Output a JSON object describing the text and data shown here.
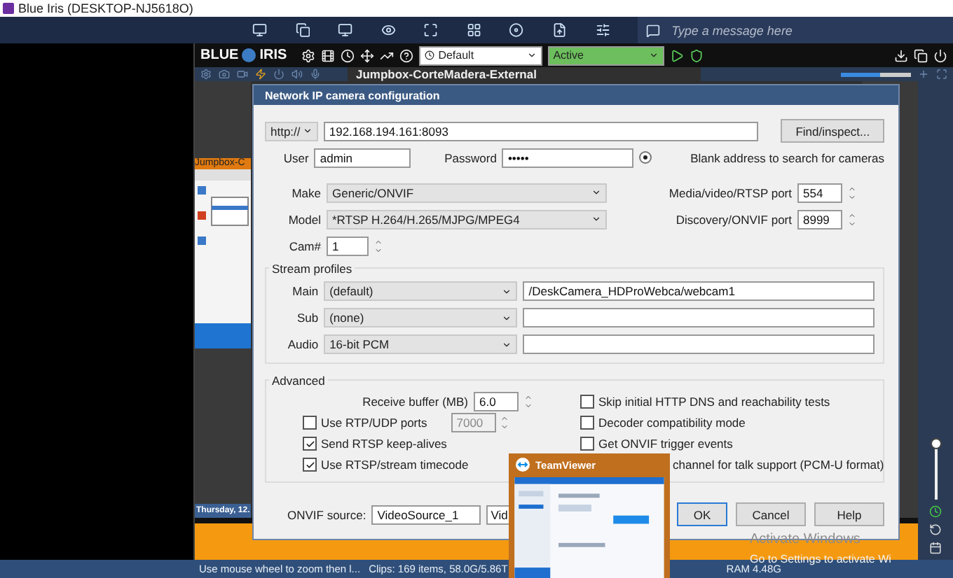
{
  "window": {
    "title": "Blue Iris (DESKTOP-NJ5618O)"
  },
  "remote_toolbar": {
    "message_placeholder": "Type a message here"
  },
  "app_toolbar": {
    "logo_left": "BLUE",
    "logo_right": "IRIS",
    "profile": "Default",
    "schedule": "Active"
  },
  "camera_bar": {
    "title": "Jumpbox-CorteMadera-External",
    "volume": {
      "level": 0.55
    }
  },
  "thumbnails": {
    "left_label": "Jumpbox-C",
    "date": "Thursday, 12."
  },
  "zoom_slider": {
    "level": 0.9
  },
  "dialog": {
    "title": "Network IP camera configuration",
    "protocol": "http://",
    "address": "192.168.194.161:8093",
    "find_button": "Find/inspect...",
    "user_label": "User",
    "user": "admin",
    "password_label": "Password",
    "password": "•••••",
    "hint": "Blank address to search for cameras",
    "make_label": "Make",
    "make": "Generic/ONVIF",
    "model_label": "Model",
    "model": "*RTSP H.264/H.265/MJPG/MPEG4",
    "cam_label": "Cam#",
    "cam": "1",
    "ports": [
      {
        "label": "Media/video/RTSP port",
        "value": "554"
      },
      {
        "label": "Discovery/ONVIF port",
        "value": "8999"
      }
    ],
    "stream_profiles": {
      "title": "Stream profiles",
      "rows": [
        {
          "label": "Main",
          "choice": "(default)",
          "path": "/DeskCamera_HDProWebca/webcam1"
        },
        {
          "label": "Sub",
          "choice": "(none)"
        },
        {
          "label": "Audio",
          "choice": "16-bit PCM"
        }
      ]
    },
    "advanced": {
      "title": "Advanced",
      "buffer_label": "Receive buffer (MB)",
      "buffer": "6.0",
      "left_options": [
        {
          "kind": "port",
          "label": "Use RTP/UDP ports",
          "checked": false,
          "value": "7000",
          "disabled": true
        },
        {
          "kind": "check",
          "label": "Send RTSP keep-alives",
          "checked": true
        },
        {
          "kind": "check",
          "label": "Use RTSP/stream timecode",
          "checked": true
        }
      ],
      "right_options": [
        {
          "label": "Skip initial HTTP DNS and reachability tests",
          "checked": false
        },
        {
          "label": "Decoder compatibility mode",
          "checked": false
        },
        {
          "label": "Get ONVIF trigger events",
          "checked": false
        },
        {
          "kind": "covered",
          "label": "channel for talk support (PCM-U format)"
        }
      ]
    },
    "onvif_label": "ONVIF source:",
    "onvif_source": "VideoSource_1",
    "onvif_second": "Vid",
    "buttons": [
      {
        "label": "OK",
        "selected": true
      },
      {
        "label": "Cancel",
        "selected": false
      },
      {
        "label": "Help",
        "selected": false
      }
    ]
  },
  "teamviewer": {
    "title": "TeamViewer"
  },
  "activation": {
    "title": "Activate Windows",
    "subtitle": "Go to Settings to activate Wi"
  },
  "status_bar": {
    "hint": "Use mouse wheel to zoom then l...",
    "clips": "Clips: 169 items, 58.0G/5.86T",
    "ram": "RAM 4.48G"
  }
}
